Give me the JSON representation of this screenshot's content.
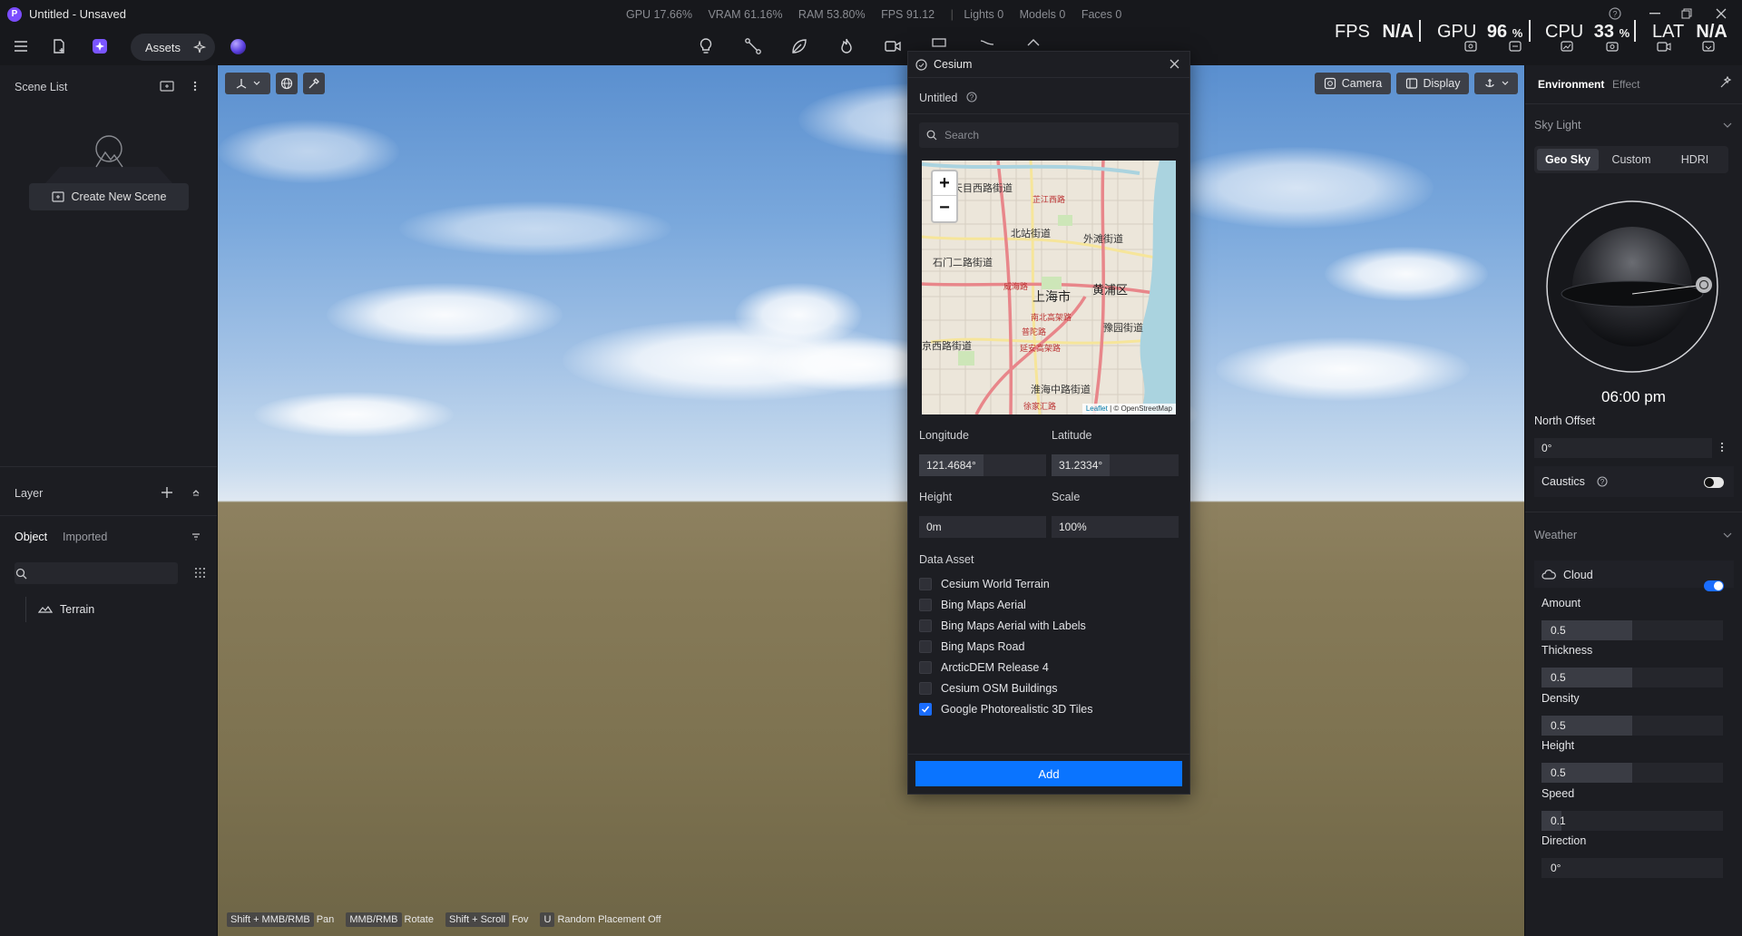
{
  "app": {
    "logo": "P",
    "title": "Untitled - Unsaved"
  },
  "stats": {
    "gpu": "GPU 17.66%",
    "vram": "VRAM 61.16%",
    "ram": "RAM 53.80%",
    "fps": "FPS 91.12",
    "lights": "Lights 0",
    "models": "Models 0",
    "faces": "Faces 0"
  },
  "toolbar": {
    "assets_label": "Assets"
  },
  "hud": {
    "fps_label": "FPS",
    "fps_value": "N/A",
    "gpu_label": "GPU",
    "gpu_value": "96",
    "gpu_unit": "%",
    "cpu_label": "CPU",
    "cpu_value": "33",
    "cpu_unit": "%",
    "lat_label": "LAT",
    "lat_value": "N/A"
  },
  "left": {
    "scene_list_title": "Scene List",
    "create_scene_label": "Create New Scene",
    "layer_title": "Layer",
    "tabs": [
      "Object",
      "Imported"
    ],
    "tree_items": [
      "Terrain"
    ]
  },
  "viewport": {
    "camera_label": "Camera",
    "display_label": "Display",
    "hints": [
      {
        "key": "Shift + MMB/RMB",
        "action": "Pan"
      },
      {
        "key": "MMB/RMB",
        "action": "Rotate"
      },
      {
        "key": "Shift + Scroll",
        "action": "Fov"
      },
      {
        "key": "U",
        "action": "Random Placement Off"
      }
    ]
  },
  "cesium": {
    "title": "Cesium",
    "project_name": "Untitled",
    "search_placeholder": "Search",
    "map": {
      "zoom_in": "+",
      "zoom_out": "−",
      "labels": [
        "天目西路街道",
        "芷江西路",
        "北站街道",
        "外滩街道",
        "石门二路街道",
        "威海路",
        "上海市",
        "黄浦区",
        "南北高架路",
        "豫园街道",
        "京西路街道",
        "延安高架路",
        "淮海中路街道",
        "徐家汇路",
        "普陀路"
      ],
      "attribution_leaflet": "Leaflet",
      "attribution_osm": "| © OpenStreetMap"
    },
    "longitude_label": "Longitude",
    "longitude_value": "121.4684°",
    "latitude_label": "Latitude",
    "latitude_value": "31.2334°",
    "height_label": "Height",
    "height_value": "0m",
    "scale_label": "Scale",
    "scale_value": "100%",
    "data_asset_label": "Data Asset",
    "assets": [
      {
        "label": "Cesium World Terrain",
        "checked": false
      },
      {
        "label": "Bing Maps Aerial",
        "checked": false
      },
      {
        "label": "Bing Maps Aerial with Labels",
        "checked": false
      },
      {
        "label": "Bing Maps Road",
        "checked": false
      },
      {
        "label": "ArcticDEM Release 4",
        "checked": false
      },
      {
        "label": "Cesium OSM Buildings",
        "checked": false
      },
      {
        "label": "Google Photorealistic 3D Tiles",
        "checked": true
      }
    ],
    "add_label": "Add"
  },
  "right": {
    "tabs": [
      "Environment",
      "Effect"
    ],
    "sky_light_label": "Sky Light",
    "sky_modes": [
      "Geo Sky",
      "Custom",
      "HDRI"
    ],
    "time": "06:00 pm",
    "north_offset_label": "North Offset",
    "north_offset_value": "0°",
    "caustics_label": "Caustics",
    "caustics_on": false,
    "weather_label": "Weather",
    "cloud_label": "Cloud",
    "cloud_on": true,
    "sliders": [
      {
        "label": "Amount",
        "value": "0.5",
        "level": 0.5
      },
      {
        "label": "Thickness",
        "value": "0.5",
        "level": 0.5
      },
      {
        "label": "Density",
        "value": "0.5",
        "level": 0.5
      },
      {
        "label": "Height",
        "value": "0.5",
        "level": 0.5
      },
      {
        "label": "Speed",
        "value": "0.1",
        "level": 0.1
      },
      {
        "label": "Direction",
        "value": "0°",
        "level": 0.0
      }
    ],
    "accent_color": "#1a6dff"
  }
}
